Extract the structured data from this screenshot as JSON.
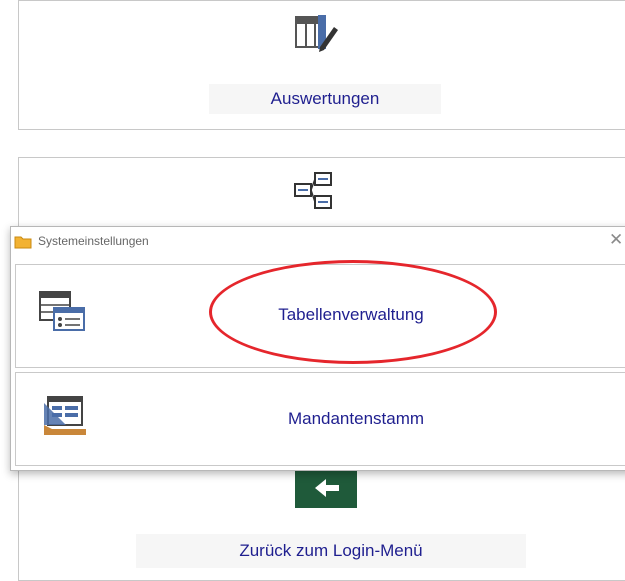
{
  "menu": {
    "auswertungen_label": "Auswertungen",
    "back_label": "Zurück zum Login-Menü"
  },
  "popup": {
    "title": "Systemeinstellungen",
    "close_symbol": "✕",
    "items": [
      {
        "label": "Tabellenverwaltung",
        "icon": "table-settings-icon"
      },
      {
        "label": "Mandantenstamm",
        "icon": "form-ruler-icon"
      }
    ]
  },
  "icons": {
    "auswertungen": "table-edit-icon",
    "hierarchy": "hierarchy-icon",
    "back": "left-arrow-icon"
  },
  "colors": {
    "label_text": "#1f1f8f",
    "icon_blue": "#4a6da8",
    "back_button": "#1f5a3a",
    "annotation": "#e5262c"
  }
}
